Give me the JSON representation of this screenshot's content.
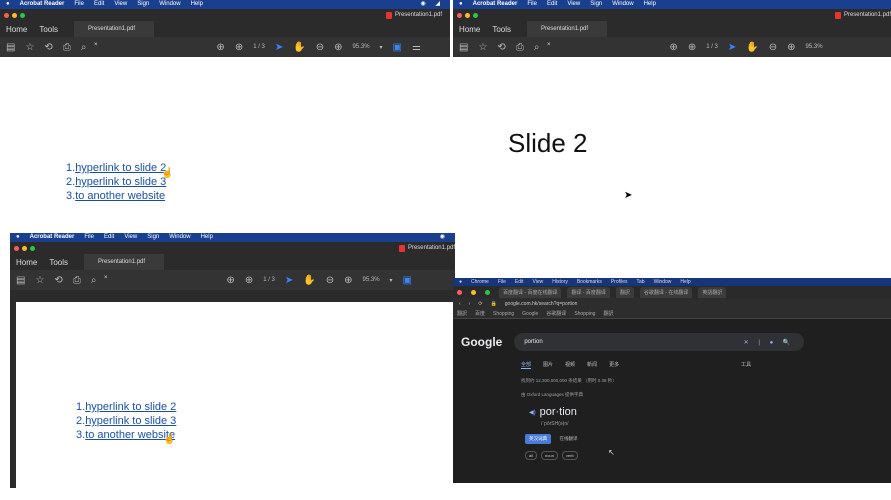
{
  "mac_menu": {
    "app": "Acrobat Reader",
    "items": [
      "File",
      "Edit",
      "View",
      "Sign",
      "Window",
      "Help"
    ]
  },
  "acrobat": {
    "file_title": "Presentation1.pdf",
    "nav_home": "Home",
    "nav_tools": "Tools",
    "doc_tab": "Presentation1.pdf",
    "tab_close": "×",
    "page_indicator": "1 / 3",
    "zoom": "95.3%",
    "zoom_caret": "▾"
  },
  "slide1": {
    "items": [
      {
        "num": "1.",
        "text": "hyperlink to slide 2"
      },
      {
        "num": "2.",
        "text": "hyperlink to slide 3"
      },
      {
        "num": "3.",
        "text": "to another website"
      }
    ]
  },
  "slide2": {
    "title": "Slide 2"
  },
  "chrome": {
    "menu": [
      "Chrome",
      "File",
      "Edit",
      "View",
      "History",
      "Bookmarks",
      "Profiles",
      "Tab",
      "Window",
      "Help"
    ],
    "tabs": [
      "百度翻译 - 百度在线翻译",
      "翻译 - 百度翻译",
      "翻訳",
      "谷歌翻译 - 在线翻译",
      "英語翻訳"
    ],
    "url": "google.com.hk/search?q=portion",
    "bookmarks": [
      "翻訳",
      "百度",
      "Shopping",
      "Google",
      "谷歌翻译",
      "Shopping",
      "翻訳"
    ],
    "search_query": "portion",
    "search_tools": "✕ | ● 🔍",
    "result_tabs": [
      "全部",
      "图片",
      "视频",
      "新闻",
      "更多"
    ],
    "tools_label": "工具",
    "result_stats": "找到约 12,300,000,000 条结果 （用时 0.38 秒）",
    "dictionary_line": "由 Oxford Languages 提供字典",
    "word": "por·tion",
    "pronunciation": "/ˈpôrSH(ə)n/",
    "chip_primary": "英汉词典",
    "chip_secondary": "在线翻译",
    "pills": [
      "all",
      "noun",
      "verb"
    ]
  }
}
